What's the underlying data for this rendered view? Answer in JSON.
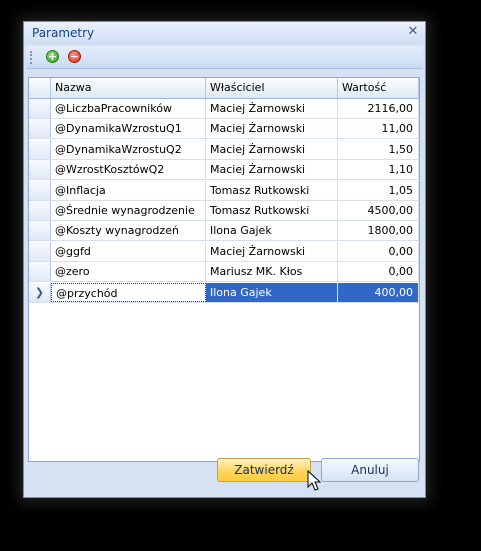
{
  "window": {
    "title": "Parametry",
    "close_glyph": "✕"
  },
  "toolbar": {
    "add_icon": "add-icon",
    "remove_icon": "remove-icon"
  },
  "grid": {
    "columns": [
      "Nazwa",
      "Właściciel",
      "Wartość"
    ],
    "rows": [
      {
        "name": "@LiczbaPracowników",
        "owner": "Maciej Żarnowski",
        "value": "2116,00"
      },
      {
        "name": "@DynamikaWzrostuQ1",
        "owner": "Maciej Żarnowski",
        "value": "11,00"
      },
      {
        "name": "@DynamikaWzrostuQ2",
        "owner": "Maciej Żarnowski",
        "value": "1,50"
      },
      {
        "name": "@WzrostKosztówQ2",
        "owner": "Maciej Żarnowski",
        "value": "1,10"
      },
      {
        "name": "@Inflacja",
        "owner": "Tomasz Rutkowski",
        "value": "1,05"
      },
      {
        "name": "@Średnie wynagrodzenie",
        "owner": "Tomasz Rutkowski",
        "value": "4500,00"
      },
      {
        "name": "@Koszty wynagrodzeń",
        "owner": "Ilona Gajek",
        "value": "1800,00"
      },
      {
        "name": "@ggfd",
        "owner": "Maciej Żarnowski",
        "value": "0,00"
      },
      {
        "name": "@zero",
        "owner": "Mariusz MK. Kłos",
        "value": "0,00"
      },
      {
        "name": "@przychód",
        "owner": "Ilona Gajek",
        "value": "400,00"
      }
    ],
    "current_row_marker": "❯"
  },
  "buttons": {
    "confirm": "Zatwierdź",
    "cancel": "Anuluj"
  },
  "colors": {
    "selection": "#3168c8",
    "confirm_button": "#ffd65e",
    "window_bg": "#d5e2f4"
  }
}
